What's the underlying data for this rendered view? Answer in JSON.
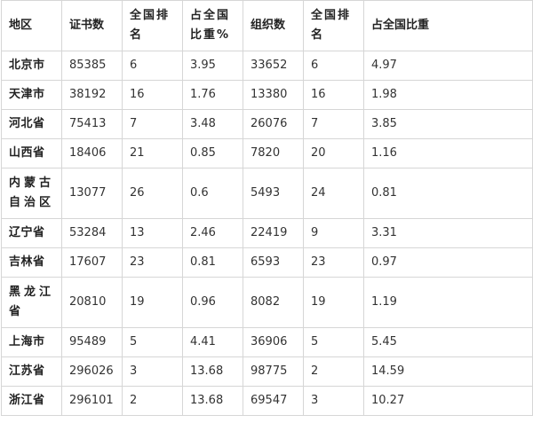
{
  "headers": [
    "地区",
    "证书数",
    "全国排名",
    "占全国比重%",
    "组织数",
    "全国排名",
    "占全国比重"
  ],
  "rows": [
    [
      "北京市",
      "85385",
      "6",
      "3.95",
      "33652",
      "6",
      "4.97"
    ],
    [
      "天津市",
      "38192",
      "16",
      "1.76",
      "13380",
      "16",
      "1.98"
    ],
    [
      "河北省",
      "75413",
      "7",
      "3.48",
      "26076",
      "7",
      "3.85"
    ],
    [
      "山西省",
      "18406",
      "21",
      "0.85",
      "7820",
      "20",
      "1.16"
    ],
    [
      "内蒙古自治区",
      "13077",
      "26",
      "0.6",
      "5493",
      "24",
      "0.81"
    ],
    [
      "辽宁省",
      "53284",
      "13",
      "2.46",
      "22419",
      "9",
      "3.31"
    ],
    [
      "吉林省",
      "17607",
      "23",
      "0.81",
      "6593",
      "23",
      "0.97"
    ],
    [
      "黑龙江省",
      "20810",
      "19",
      "0.96",
      "8082",
      "19",
      "1.19"
    ],
    [
      "上海市",
      "95489",
      "5",
      "4.41",
      "36906",
      "5",
      "5.45"
    ],
    [
      "江苏省",
      "296026",
      "3",
      "13.68",
      "98775",
      "2",
      "14.59"
    ],
    [
      "浙江省",
      "296101",
      "2",
      "13.68",
      "69547",
      "3",
      "10.27"
    ]
  ]
}
